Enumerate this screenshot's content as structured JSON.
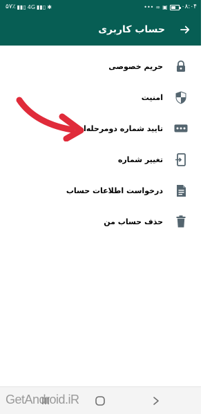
{
  "status_bar": {
    "time": "۰۸:۰۴",
    "battery_percent": "۵۷٪",
    "network": "4G",
    "battery_level": 0.57
  },
  "header": {
    "title": "حساب کاربری",
    "back_icon": "arrow-forward-icon"
  },
  "colors": {
    "primary": "#075e54",
    "icon": "#54656f",
    "text": "#000000",
    "annotation": "#e02b3a"
  },
  "menu": {
    "items": [
      {
        "label": "حریم خصوصی",
        "icon": "lock-icon"
      },
      {
        "label": "امنیت",
        "icon": "shield-icon"
      },
      {
        "label": "تایید شماره دومرحله‌ای",
        "icon": "dots-key-icon"
      },
      {
        "label": "تغییر شماره",
        "icon": "phone-swap-icon"
      },
      {
        "label": "درخواست اطلاعات حساب",
        "icon": "document-icon"
      },
      {
        "label": "حذف حساب من",
        "icon": "trash-icon"
      }
    ]
  },
  "navigation": {
    "recent_icon": "recent-apps-icon",
    "home_icon": "home-circle-icon",
    "back_icon": "nav-back-icon"
  },
  "watermark": {
    "text": "GetAndroid.iR"
  }
}
